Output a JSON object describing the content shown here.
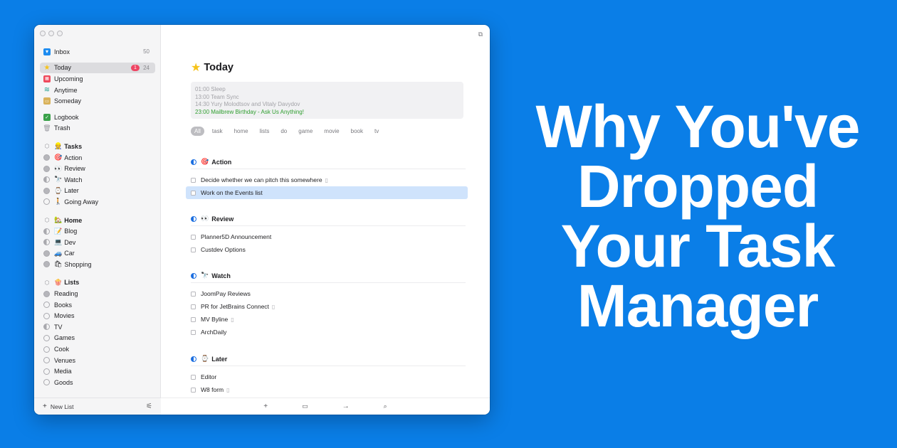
{
  "headline": [
    "Why You've",
    "Dropped",
    "Your Task",
    "Manager"
  ],
  "sidebar": {
    "inbox": {
      "label": "Inbox",
      "count": "50"
    },
    "today": {
      "label": "Today",
      "badge": "1",
      "count": "24"
    },
    "upcoming": "Upcoming",
    "anytime": "Anytime",
    "someday": "Someday",
    "logbook": "Logbook",
    "trash": "Trash",
    "areas": [
      {
        "label": "Tasks",
        "emoji": "👷",
        "items": [
          {
            "label": "Action",
            "emoji": "🎯"
          },
          {
            "label": "Review",
            "emoji": "👀"
          },
          {
            "label": "Watch",
            "emoji": "🔭"
          },
          {
            "label": "Later",
            "emoji": "⌚"
          },
          {
            "label": "Going Away",
            "emoji": "🚶"
          }
        ]
      },
      {
        "label": "Home",
        "emoji": "🏡",
        "items": [
          {
            "label": "Blog",
            "emoji": "📝"
          },
          {
            "label": "Dev",
            "emoji": "💻"
          },
          {
            "label": "Car",
            "emoji": "🚙"
          },
          {
            "label": "Shopping",
            "emoji": "🛍"
          }
        ]
      },
      {
        "label": "Lists",
        "emoji": "🍿",
        "items": [
          {
            "label": "Reading"
          },
          {
            "label": "Books"
          },
          {
            "label": "Movies"
          },
          {
            "label": "TV"
          },
          {
            "label": "Games"
          },
          {
            "label": "Cook"
          },
          {
            "label": "Venues"
          },
          {
            "label": "Media"
          },
          {
            "label": "Goods"
          }
        ]
      }
    ],
    "new_list": "New List"
  },
  "main": {
    "title": "Today",
    "calendar": [
      "01:00 Sleep",
      "13:00 Team Sync",
      "14:30 Yury Molodtsov and Vitaly Davydov",
      "23:00 Mailbrew Birthday - Ask Us Anything!"
    ],
    "tags": [
      "All",
      "task",
      "home",
      "lists",
      "do",
      "game",
      "movie",
      "book",
      "tv"
    ],
    "sections": [
      {
        "title": "Action",
        "emoji": "🎯",
        "tasks": [
          {
            "label": "Decide whether we can pitch this somewhere",
            "note": true
          },
          {
            "label": "Work on the Events list",
            "selected": true
          }
        ]
      },
      {
        "title": "Review",
        "emoji": "👀",
        "tasks": [
          {
            "label": "Planner5D Announcement"
          },
          {
            "label": "Custdev Options"
          }
        ]
      },
      {
        "title": "Watch",
        "emoji": "🔭",
        "tasks": [
          {
            "label": "JoomPay Reviews"
          },
          {
            "label": "PR for JetBrains Connect",
            "note": true
          },
          {
            "label": "MV Byline",
            "note": true
          },
          {
            "label": "ArchDaily"
          }
        ]
      },
      {
        "title": "Later",
        "emoji": "⌚",
        "tasks": [
          {
            "label": "Editor"
          },
          {
            "label": "W8 form",
            "note": true
          }
        ]
      }
    ]
  },
  "colors": {
    "background": "#0a7ee7",
    "accent": "#1d6fe0",
    "badge": "#ee4563",
    "selection": "#cfe3fc"
  }
}
